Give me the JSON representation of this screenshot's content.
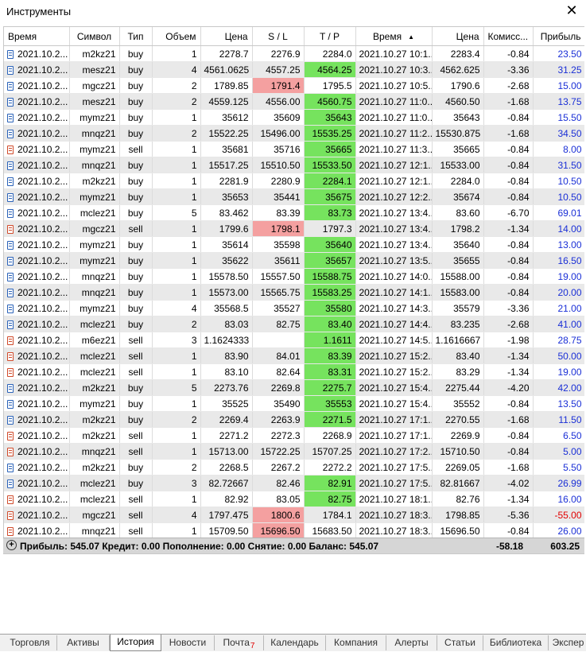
{
  "window": {
    "title": "Инструменты",
    "close_label": "✕"
  },
  "columns": [
    "Время",
    "Символ",
    "Тип",
    "Объем",
    "Цена",
    "S / L",
    "T / P",
    "Время",
    "Цена",
    "Комисс...",
    "Прибыль"
  ],
  "sort_indicator": "▲",
  "rows": [
    {
      "t1": "2021.10.2...",
      "sym": "m2kz21",
      "type": "buy",
      "vol": "1",
      "p1": "2278.7",
      "sl": "2276.9",
      "tp": "2284.0",
      "t2": "2021.10.27 10:1...",
      "p2": "2283.4",
      "comm": "-0.84",
      "profit": "23.50",
      "hit": ""
    },
    {
      "t1": "2021.10.2...",
      "sym": "mesz21",
      "type": "buy",
      "vol": "4",
      "p1": "4561.0625",
      "sl": "4557.25",
      "tp": "4564.25",
      "t2": "2021.10.27 10:3...",
      "p2": "4562.625",
      "comm": "-3.36",
      "profit": "31.25",
      "hit": "tp"
    },
    {
      "t1": "2021.10.2...",
      "sym": "mgcz21",
      "type": "buy",
      "vol": "2",
      "p1": "1789.85",
      "sl": "1791.4",
      "tp": "1795.5",
      "t2": "2021.10.27 10:5...",
      "p2": "1790.6",
      "comm": "-2.68",
      "profit": "15.00",
      "hit": "sl"
    },
    {
      "t1": "2021.10.2...",
      "sym": "mesz21",
      "type": "buy",
      "vol": "2",
      "p1": "4559.125",
      "sl": "4556.00",
      "tp": "4560.75",
      "t2": "2021.10.27 11:0...",
      "p2": "4560.50",
      "comm": "-1.68",
      "profit": "13.75",
      "hit": "tp"
    },
    {
      "t1": "2021.10.2...",
      "sym": "mymz21",
      "type": "buy",
      "vol": "1",
      "p1": "35612",
      "sl": "35609",
      "tp": "35643",
      "t2": "2021.10.27 11:0...",
      "p2": "35643",
      "comm": "-0.84",
      "profit": "15.50",
      "hit": "tp"
    },
    {
      "t1": "2021.10.2...",
      "sym": "mnqz21",
      "type": "buy",
      "vol": "2",
      "p1": "15522.25",
      "sl": "15496.00",
      "tp": "15535.25",
      "t2": "2021.10.27 11:2...",
      "p2": "15530.875",
      "comm": "-1.68",
      "profit": "34.50",
      "hit": "tp"
    },
    {
      "t1": "2021.10.2...",
      "sym": "mymz21",
      "type": "sell",
      "vol": "1",
      "p1": "35681",
      "sl": "35716",
      "tp": "35665",
      "t2": "2021.10.27 11:3...",
      "p2": "35665",
      "comm": "-0.84",
      "profit": "8.00",
      "hit": "tp"
    },
    {
      "t1": "2021.10.2...",
      "sym": "mnqz21",
      "type": "buy",
      "vol": "1",
      "p1": "15517.25",
      "sl": "15510.50",
      "tp": "15533.50",
      "t2": "2021.10.27 12:1...",
      "p2": "15533.00",
      "comm": "-0.84",
      "profit": "31.50",
      "hit": "tp"
    },
    {
      "t1": "2021.10.2...",
      "sym": "m2kz21",
      "type": "buy",
      "vol": "1",
      "p1": "2281.9",
      "sl": "2280.9",
      "tp": "2284.1",
      "t2": "2021.10.27 12:1...",
      "p2": "2284.0",
      "comm": "-0.84",
      "profit": "10.50",
      "hit": "tp"
    },
    {
      "t1": "2021.10.2...",
      "sym": "mymz21",
      "type": "buy",
      "vol": "1",
      "p1": "35653",
      "sl": "35441",
      "tp": "35675",
      "t2": "2021.10.27 12:2...",
      "p2": "35674",
      "comm": "-0.84",
      "profit": "10.50",
      "hit": "tp"
    },
    {
      "t1": "2021.10.2...",
      "sym": "mclez21",
      "type": "buy",
      "vol": "5",
      "p1": "83.462",
      "sl": "83.39",
      "tp": "83.73",
      "t2": "2021.10.27 13:4...",
      "p2": "83.60",
      "comm": "-6.70",
      "profit": "69.01",
      "hit": "tp"
    },
    {
      "t1": "2021.10.2...",
      "sym": "mgcz21",
      "type": "sell",
      "vol": "1",
      "p1": "1799.6",
      "sl": "1798.1",
      "tp": "1797.3",
      "t2": "2021.10.27 13:4...",
      "p2": "1798.2",
      "comm": "-1.34",
      "profit": "14.00",
      "hit": "sl"
    },
    {
      "t1": "2021.10.2...",
      "sym": "mymz21",
      "type": "buy",
      "vol": "1",
      "p1": "35614",
      "sl": "35598",
      "tp": "35640",
      "t2": "2021.10.27 13:4...",
      "p2": "35640",
      "comm": "-0.84",
      "profit": "13.00",
      "hit": "tp"
    },
    {
      "t1": "2021.10.2...",
      "sym": "mymz21",
      "type": "buy",
      "vol": "1",
      "p1": "35622",
      "sl": "35611",
      "tp": "35657",
      "t2": "2021.10.27 13:5...",
      "p2": "35655",
      "comm": "-0.84",
      "profit": "16.50",
      "hit": "tp"
    },
    {
      "t1": "2021.10.2...",
      "sym": "mnqz21",
      "type": "buy",
      "vol": "1",
      "p1": "15578.50",
      "sl": "15557.50",
      "tp": "15588.75",
      "t2": "2021.10.27 14:0...",
      "p2": "15588.00",
      "comm": "-0.84",
      "profit": "19.00",
      "hit": "tp"
    },
    {
      "t1": "2021.10.2...",
      "sym": "mnqz21",
      "type": "buy",
      "vol": "1",
      "p1": "15573.00",
      "sl": "15565.75",
      "tp": "15583.25",
      "t2": "2021.10.27 14:1...",
      "p2": "15583.00",
      "comm": "-0.84",
      "profit": "20.00",
      "hit": "tp"
    },
    {
      "t1": "2021.10.2...",
      "sym": "mymz21",
      "type": "buy",
      "vol": "4",
      "p1": "35568.5",
      "sl": "35527",
      "tp": "35580",
      "t2": "2021.10.27 14:3...",
      "p2": "35579",
      "comm": "-3.36",
      "profit": "21.00",
      "hit": "tp"
    },
    {
      "t1": "2021.10.2...",
      "sym": "mclez21",
      "type": "buy",
      "vol": "2",
      "p1": "83.03",
      "sl": "82.75",
      "tp": "83.40",
      "t2": "2021.10.27 14:4...",
      "p2": "83.235",
      "comm": "-2.68",
      "profit": "41.00",
      "hit": "tp"
    },
    {
      "t1": "2021.10.2...",
      "sym": "m6ez21",
      "type": "sell",
      "vol": "3",
      "p1": "1.1624333",
      "sl": "",
      "tp": "1.1611",
      "t2": "2021.10.27 14:5...",
      "p2": "1.1616667",
      "comm": "-1.98",
      "profit": "28.75",
      "hit": "tp"
    },
    {
      "t1": "2021.10.2...",
      "sym": "mclez21",
      "type": "sell",
      "vol": "1",
      "p1": "83.90",
      "sl": "84.01",
      "tp": "83.39",
      "t2": "2021.10.27 15:2...",
      "p2": "83.40",
      "comm": "-1.34",
      "profit": "50.00",
      "hit": "tp"
    },
    {
      "t1": "2021.10.2...",
      "sym": "mclez21",
      "type": "sell",
      "vol": "1",
      "p1": "83.10",
      "sl": "82.64",
      "tp": "83.31",
      "t2": "2021.10.27 15:2...",
      "p2": "83.29",
      "comm": "-1.34",
      "profit": "19.00",
      "hit": "tp"
    },
    {
      "t1": "2021.10.2...",
      "sym": "m2kz21",
      "type": "buy",
      "vol": "5",
      "p1": "2273.76",
      "sl": "2269.8",
      "tp": "2275.7",
      "t2": "2021.10.27 15:4...",
      "p2": "2275.44",
      "comm": "-4.20",
      "profit": "42.00",
      "hit": "tp"
    },
    {
      "t1": "2021.10.2...",
      "sym": "mymz21",
      "type": "buy",
      "vol": "1",
      "p1": "35525",
      "sl": "35490",
      "tp": "35553",
      "t2": "2021.10.27 15:4...",
      "p2": "35552",
      "comm": "-0.84",
      "profit": "13.50",
      "hit": "tp"
    },
    {
      "t1": "2021.10.2...",
      "sym": "m2kz21",
      "type": "buy",
      "vol": "2",
      "p1": "2269.4",
      "sl": "2263.9",
      "tp": "2271.5",
      "t2": "2021.10.27 17:1...",
      "p2": "2270.55",
      "comm": "-1.68",
      "profit": "11.50",
      "hit": "tp"
    },
    {
      "t1": "2021.10.2...",
      "sym": "m2kz21",
      "type": "sell",
      "vol": "1",
      "p1": "2271.2",
      "sl": "2272.3",
      "tp": "2268.9",
      "t2": "2021.10.27 17:1...",
      "p2": "2269.9",
      "comm": "-0.84",
      "profit": "6.50",
      "hit": ""
    },
    {
      "t1": "2021.10.2...",
      "sym": "mnqz21",
      "type": "sell",
      "vol": "1",
      "p1": "15713.00",
      "sl": "15722.25",
      "tp": "15707.25",
      "t2": "2021.10.27 17:2...",
      "p2": "15710.50",
      "comm": "-0.84",
      "profit": "5.00",
      "hit": ""
    },
    {
      "t1": "2021.10.2...",
      "sym": "m2kz21",
      "type": "buy",
      "vol": "2",
      "p1": "2268.5",
      "sl": "2267.2",
      "tp": "2272.2",
      "t2": "2021.10.27 17:5...",
      "p2": "2269.05",
      "comm": "-1.68",
      "profit": "5.50",
      "hit": ""
    },
    {
      "t1": "2021.10.2...",
      "sym": "mclez21",
      "type": "buy",
      "vol": "3",
      "p1": "82.72667",
      "sl": "82.46",
      "tp": "82.91",
      "t2": "2021.10.27 17:5...",
      "p2": "82.81667",
      "comm": "-4.02",
      "profit": "26.99",
      "hit": "tp"
    },
    {
      "t1": "2021.10.2...",
      "sym": "mclez21",
      "type": "sell",
      "vol": "1",
      "p1": "82.92",
      "sl": "83.05",
      "tp": "82.75",
      "t2": "2021.10.27 18:1...",
      "p2": "82.76",
      "comm": "-1.34",
      "profit": "16.00",
      "hit": "tp"
    },
    {
      "t1": "2021.10.2...",
      "sym": "mgcz21",
      "type": "sell",
      "vol": "4",
      "p1": "1797.475",
      "sl": "1800.6",
      "tp": "1784.1",
      "t2": "2021.10.27 18:3...",
      "p2": "1798.85",
      "comm": "-5.36",
      "profit": "-55.00",
      "hit": "sl"
    },
    {
      "t1": "2021.10.2...",
      "sym": "mnqz21",
      "type": "sell",
      "vol": "1",
      "p1": "15709.50",
      "sl": "15696.50",
      "tp": "15683.50",
      "t2": "2021.10.27 18:3...",
      "p2": "15696.50",
      "comm": "-0.84",
      "profit": "26.00",
      "hit": "sl"
    }
  ],
  "summary": {
    "text": "Прибыль: 545.07  Кредит: 0.00  Пополнение: 0.00  Снятие: 0.00  Баланс: 545.07",
    "commission": "-58.18",
    "profit": "603.25"
  },
  "tabs": [
    {
      "label": "Торговля",
      "active": false,
      "badge": ""
    },
    {
      "label": "Активы",
      "active": false,
      "badge": ""
    },
    {
      "label": "История",
      "active": true,
      "badge": ""
    },
    {
      "label": "Новости",
      "active": false,
      "badge": ""
    },
    {
      "label": "Почта",
      "active": false,
      "badge": "7"
    },
    {
      "label": "Календарь",
      "active": false,
      "badge": ""
    },
    {
      "label": "Компания",
      "active": false,
      "badge": ""
    },
    {
      "label": "Алерты",
      "active": false,
      "badge": ""
    },
    {
      "label": "Статьи",
      "active": false,
      "badge": ""
    },
    {
      "label": "Библиотека",
      "active": false,
      "badge": ""
    },
    {
      "label": "Экспер",
      "active": false,
      "badge": ""
    }
  ]
}
